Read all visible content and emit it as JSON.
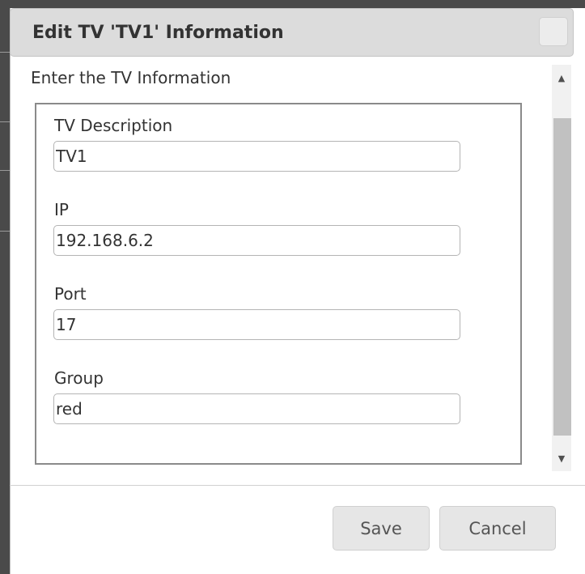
{
  "dialog": {
    "title": "Edit TV 'TV1' Information",
    "subtitle": "Enter the TV Information",
    "fields": [
      {
        "label": "TV Description",
        "value": "TV1"
      },
      {
        "label": "IP",
        "value": "192.168.6.2"
      },
      {
        "label": "Port",
        "value": "17"
      },
      {
        "label": "Group",
        "value": "red"
      }
    ],
    "buttons": {
      "save": "Save",
      "cancel": "Cancel"
    }
  },
  "icons": {
    "close": "close-icon",
    "scroll_up": "chevron-up-icon",
    "scroll_down": "chevron-down-icon"
  }
}
